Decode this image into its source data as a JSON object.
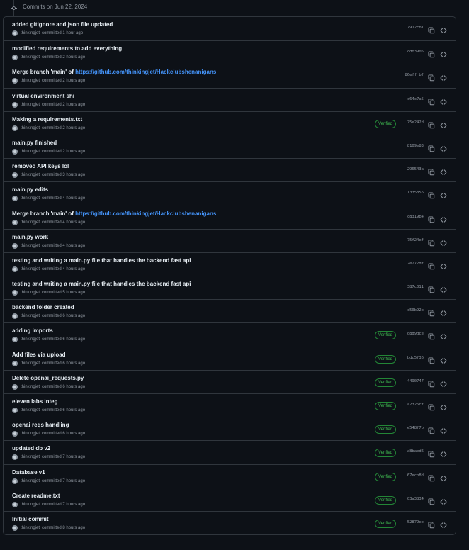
{
  "header": {
    "title": "Commits on Jun 22, 2024"
  },
  "link_text": "https://github.com/thinkingjet/Hackclubshenanigans",
  "verified_label": "Verified",
  "commits": [
    {
      "message": "added gitignore and json file updated",
      "link": "",
      "author": "thinkingjet",
      "time": "committed 1 hour ago",
      "sha": "7912cb1",
      "verified": false
    },
    {
      "message": "modified requirements to add everything",
      "link": "",
      "author": "thinkingjet",
      "time": "committed 2 hours ago",
      "sha": "cdf3905",
      "verified": false
    },
    {
      "message": "Merge branch 'main' of ",
      "link": "https://github.com/thinkingjet/Hackclubshenanigans",
      "author": "thinkingjet",
      "time": "committed 2 hours ago",
      "sha": "86eff bf",
      "verified": false
    },
    {
      "message": "virtual environment shi",
      "link": "",
      "author": "thinkingjet",
      "time": "committed 2 hours ago",
      "sha": "c64c7a5",
      "verified": false
    },
    {
      "message": "Making a requirements.txt",
      "link": "",
      "author": "thinkingjet",
      "time": "committed 2 hours ago",
      "sha": "75e242d",
      "verified": true
    },
    {
      "message": "main.py finished",
      "link": "",
      "author": "thinkingjet",
      "time": "committed 2 hours ago",
      "sha": "8109e83",
      "verified": false
    },
    {
      "message": "removed API keys lol",
      "link": "",
      "author": "thinkingjet",
      "time": "committed 3 hours ago",
      "sha": "296543a",
      "verified": false
    },
    {
      "message": "main.py edits",
      "link": "",
      "author": "thinkingjet",
      "time": "committed 4 hours ago",
      "sha": "1335856",
      "verified": false
    },
    {
      "message": "Merge branch 'main' of ",
      "link": "https://github.com/thinkingjet/Hackclubshenanigans",
      "author": "thinkingjet",
      "time": "committed 4 hours ago",
      "sha": "c8319b4",
      "verified": false
    },
    {
      "message": "main.py work",
      "link": "",
      "author": "thinkingjet",
      "time": "committed 4 hours ago",
      "sha": "75f24ef",
      "verified": false
    },
    {
      "message": "testing and writing a main.py file that handles the backend fast api",
      "link": "",
      "author": "thinkingjet",
      "time": "committed 4 hours ago",
      "sha": "2e272df",
      "verified": false
    },
    {
      "message": "testing and writing a main.py file that handles the backend fast api",
      "link": "",
      "author": "thinkingjet",
      "time": "committed 5 hours ago",
      "sha": "387c011",
      "verified": false
    },
    {
      "message": "backend folder created",
      "link": "",
      "author": "thinkingjet",
      "time": "committed 6 hours ago",
      "sha": "c50b92b",
      "verified": false
    },
    {
      "message": "adding imports",
      "link": "",
      "author": "thinkingjet",
      "time": "committed 6 hours ago",
      "sha": "d8d9dce",
      "verified": true
    },
    {
      "message": "Add files via upload",
      "link": "",
      "author": "thinkingjet",
      "time": "committed 6 hours ago",
      "sha": "bdc5f36",
      "verified": true
    },
    {
      "message": "Delete openai_requests.py",
      "link": "",
      "author": "thinkingjet",
      "time": "committed 6 hours ago",
      "sha": "4490747",
      "verified": true
    },
    {
      "message": "eleven labs integ",
      "link": "",
      "author": "thinkingjet",
      "time": "committed 6 hours ago",
      "sha": "a2326cf",
      "verified": true
    },
    {
      "message": "openai reqs handling",
      "link": "",
      "author": "thinkingjet",
      "time": "committed 6 hours ago",
      "sha": "e548f7b",
      "verified": true
    },
    {
      "message": "updated db v2",
      "link": "",
      "author": "thinkingjet",
      "time": "committed 7 hours ago",
      "sha": "a8baed6",
      "verified": true
    },
    {
      "message": "Database v1",
      "link": "",
      "author": "thinkingjet",
      "time": "committed 7 hours ago",
      "sha": "67ecb8d",
      "verified": true
    },
    {
      "message": "Create readme.txt",
      "link": "",
      "author": "thinkingjet",
      "time": "committed 7 hours ago",
      "sha": "03a3834",
      "verified": true
    },
    {
      "message": "Initial commit",
      "link": "",
      "author": "thinkingjet",
      "time": "committed 8 hours ago",
      "sha": "52879ce",
      "verified": true
    }
  ]
}
